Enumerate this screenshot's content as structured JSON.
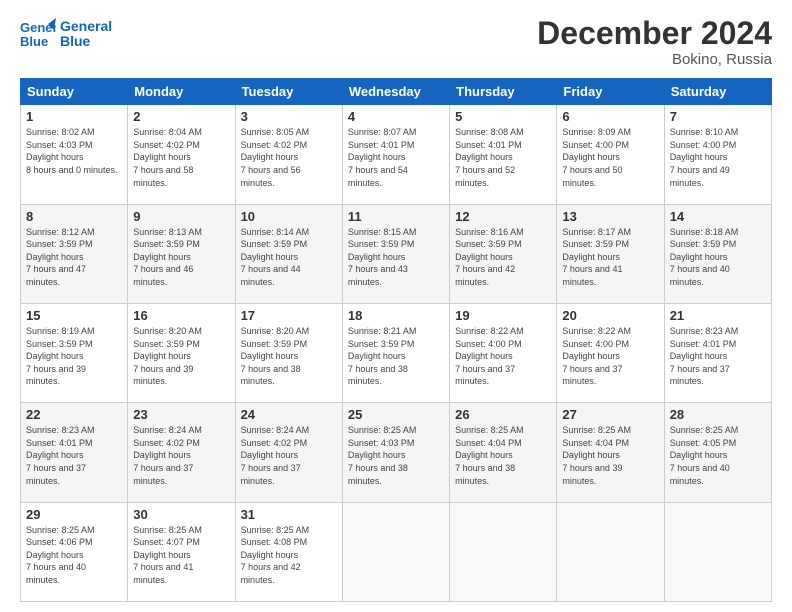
{
  "header": {
    "logo_line1": "General",
    "logo_line2": "Blue",
    "title": "December 2024",
    "subtitle": "Bokino, Russia"
  },
  "weekdays": [
    "Sunday",
    "Monday",
    "Tuesday",
    "Wednesday",
    "Thursday",
    "Friday",
    "Saturday"
  ],
  "weeks": [
    [
      {
        "day": "1",
        "sunrise": "8:02 AM",
        "sunset": "4:03 PM",
        "daylight": "8 hours and 0 minutes."
      },
      {
        "day": "2",
        "sunrise": "8:04 AM",
        "sunset": "4:02 PM",
        "daylight": "7 hours and 58 minutes."
      },
      {
        "day": "3",
        "sunrise": "8:05 AM",
        "sunset": "4:02 PM",
        "daylight": "7 hours and 56 minutes."
      },
      {
        "day": "4",
        "sunrise": "8:07 AM",
        "sunset": "4:01 PM",
        "daylight": "7 hours and 54 minutes."
      },
      {
        "day": "5",
        "sunrise": "8:08 AM",
        "sunset": "4:01 PM",
        "daylight": "7 hours and 52 minutes."
      },
      {
        "day": "6",
        "sunrise": "8:09 AM",
        "sunset": "4:00 PM",
        "daylight": "7 hours and 50 minutes."
      },
      {
        "day": "7",
        "sunrise": "8:10 AM",
        "sunset": "4:00 PM",
        "daylight": "7 hours and 49 minutes."
      }
    ],
    [
      {
        "day": "8",
        "sunrise": "8:12 AM",
        "sunset": "3:59 PM",
        "daylight": "7 hours and 47 minutes."
      },
      {
        "day": "9",
        "sunrise": "8:13 AM",
        "sunset": "3:59 PM",
        "daylight": "7 hours and 46 minutes."
      },
      {
        "day": "10",
        "sunrise": "8:14 AM",
        "sunset": "3:59 PM",
        "daylight": "7 hours and 44 minutes."
      },
      {
        "day": "11",
        "sunrise": "8:15 AM",
        "sunset": "3:59 PM",
        "daylight": "7 hours and 43 minutes."
      },
      {
        "day": "12",
        "sunrise": "8:16 AM",
        "sunset": "3:59 PM",
        "daylight": "7 hours and 42 minutes."
      },
      {
        "day": "13",
        "sunrise": "8:17 AM",
        "sunset": "3:59 PM",
        "daylight": "7 hours and 41 minutes."
      },
      {
        "day": "14",
        "sunrise": "8:18 AM",
        "sunset": "3:59 PM",
        "daylight": "7 hours and 40 minutes."
      }
    ],
    [
      {
        "day": "15",
        "sunrise": "8:19 AM",
        "sunset": "3:59 PM",
        "daylight": "7 hours and 39 minutes."
      },
      {
        "day": "16",
        "sunrise": "8:20 AM",
        "sunset": "3:59 PM",
        "daylight": "7 hours and 39 minutes."
      },
      {
        "day": "17",
        "sunrise": "8:20 AM",
        "sunset": "3:59 PM",
        "daylight": "7 hours and 38 minutes."
      },
      {
        "day": "18",
        "sunrise": "8:21 AM",
        "sunset": "3:59 PM",
        "daylight": "7 hours and 38 minutes."
      },
      {
        "day": "19",
        "sunrise": "8:22 AM",
        "sunset": "4:00 PM",
        "daylight": "7 hours and 37 minutes."
      },
      {
        "day": "20",
        "sunrise": "8:22 AM",
        "sunset": "4:00 PM",
        "daylight": "7 hours and 37 minutes."
      },
      {
        "day": "21",
        "sunrise": "8:23 AM",
        "sunset": "4:01 PM",
        "daylight": "7 hours and 37 minutes."
      }
    ],
    [
      {
        "day": "22",
        "sunrise": "8:23 AM",
        "sunset": "4:01 PM",
        "daylight": "7 hours and 37 minutes."
      },
      {
        "day": "23",
        "sunrise": "8:24 AM",
        "sunset": "4:02 PM",
        "daylight": "7 hours and 37 minutes."
      },
      {
        "day": "24",
        "sunrise": "8:24 AM",
        "sunset": "4:02 PM",
        "daylight": "7 hours and 37 minutes."
      },
      {
        "day": "25",
        "sunrise": "8:25 AM",
        "sunset": "4:03 PM",
        "daylight": "7 hours and 38 minutes."
      },
      {
        "day": "26",
        "sunrise": "8:25 AM",
        "sunset": "4:04 PM",
        "daylight": "7 hours and 38 minutes."
      },
      {
        "day": "27",
        "sunrise": "8:25 AM",
        "sunset": "4:04 PM",
        "daylight": "7 hours and 39 minutes."
      },
      {
        "day": "28",
        "sunrise": "8:25 AM",
        "sunset": "4:05 PM",
        "daylight": "7 hours and 40 minutes."
      }
    ],
    [
      {
        "day": "29",
        "sunrise": "8:25 AM",
        "sunset": "4:06 PM",
        "daylight": "7 hours and 40 minutes."
      },
      {
        "day": "30",
        "sunrise": "8:25 AM",
        "sunset": "4:07 PM",
        "daylight": "7 hours and 41 minutes."
      },
      {
        "day": "31",
        "sunrise": "8:25 AM",
        "sunset": "4:08 PM",
        "daylight": "7 hours and 42 minutes."
      },
      null,
      null,
      null,
      null
    ]
  ]
}
